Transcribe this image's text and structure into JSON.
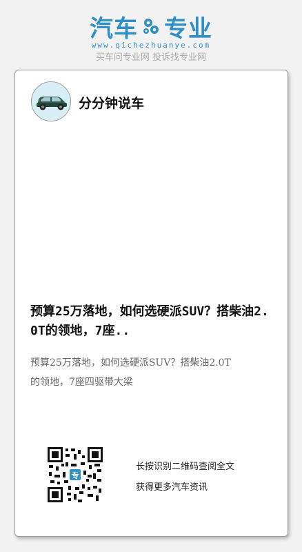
{
  "header": {
    "brand_left": "汽车",
    "brand_right": "专业",
    "site_url": "www.qichezhuanye.com",
    "slogan": "买车问专业网 投诉找专业网",
    "brand_color": "#2f8fc6"
  },
  "card": {
    "account_name": "分分钟说车",
    "avatar_icon": "car-icon",
    "article_title": "预算25万落地，如何选硬派SUV？搭柴油2.0T的领地，7座..",
    "article_summary": "预算25万落地，如何选硬派SUV？搭柴油2.0T的领地，7座四驱带大梁",
    "qr_hint_line1": "长按识别二维码查阅全文",
    "qr_hint_line2": "获得更多汽车资讯"
  }
}
